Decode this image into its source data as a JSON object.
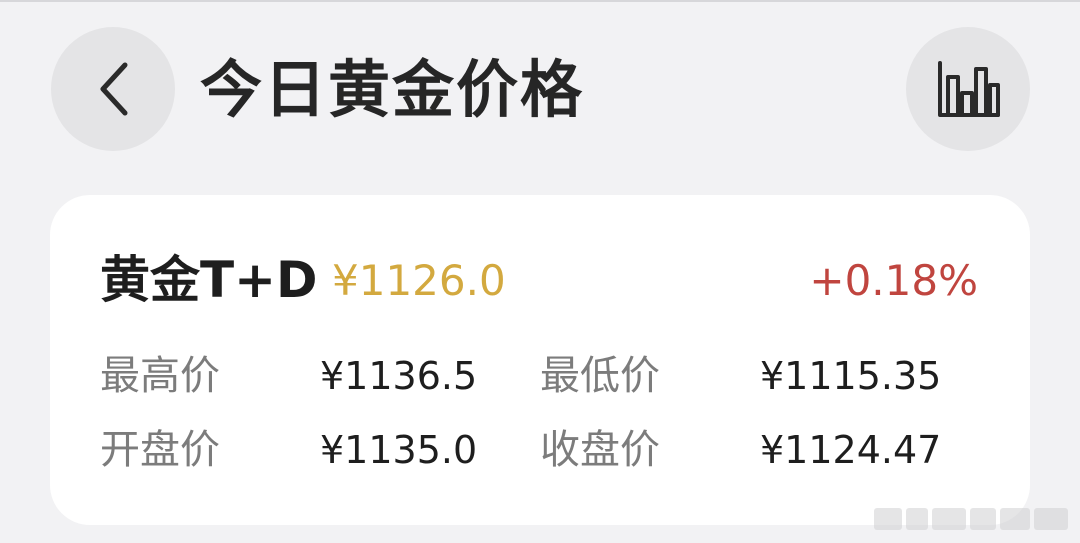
{
  "header": {
    "title": "今日黄金价格",
    "back_icon": "chevron-left-icon",
    "chart_icon": "bar-chart-icon"
  },
  "card": {
    "product_name": "黄金T+D",
    "current_price": "¥1126.0",
    "change_percent": "+0.18%",
    "stats": [
      {
        "label": "最高价",
        "value": "¥1136.5"
      },
      {
        "label": "最低价",
        "value": "¥1115.35"
      },
      {
        "label": "开盘价",
        "value": "¥1135.0"
      },
      {
        "label": "收盘价",
        "value": "¥1124.47"
      }
    ]
  },
  "colors": {
    "price": "#d3a93f",
    "change_up": "#c0453f",
    "background": "#f2f2f4",
    "card": "#ffffff"
  }
}
